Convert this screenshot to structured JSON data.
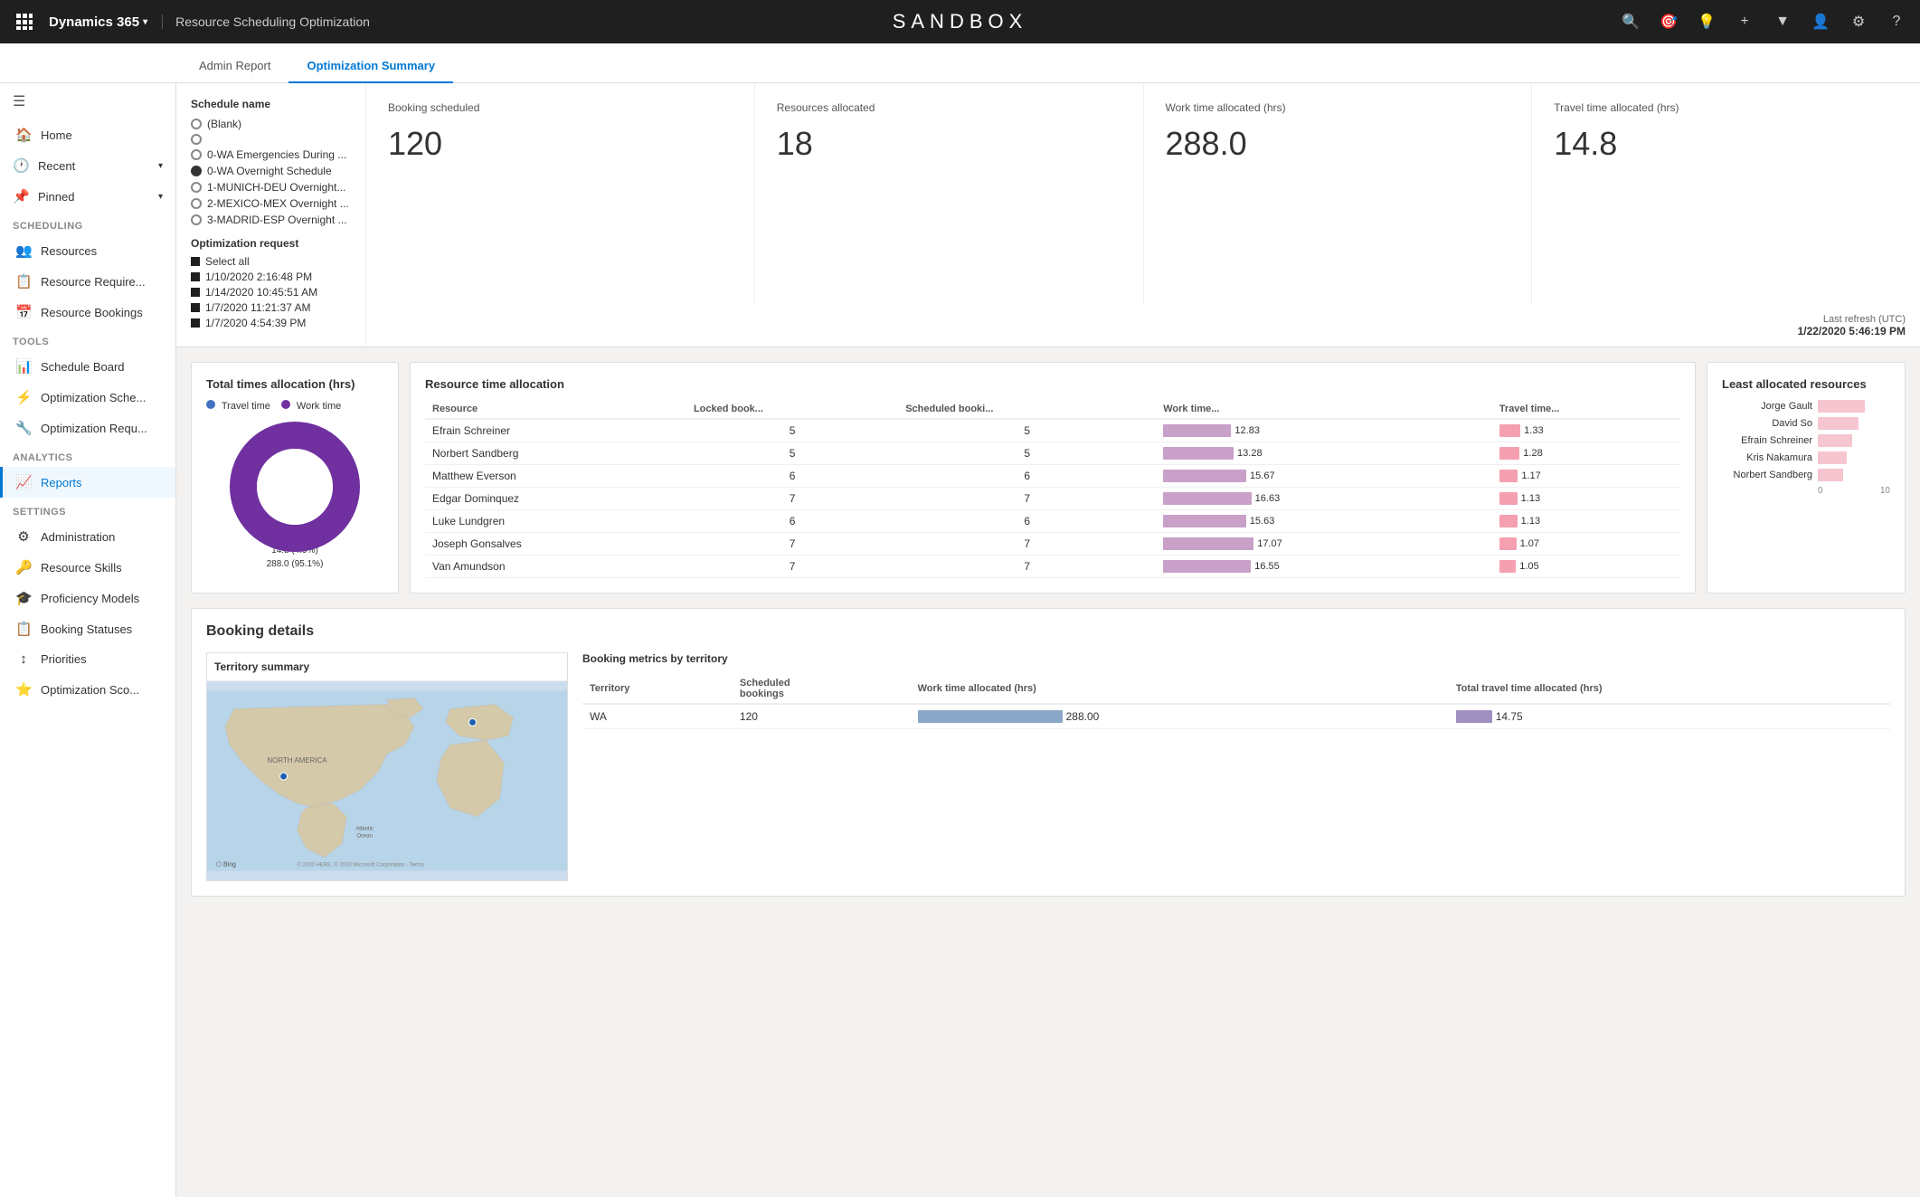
{
  "topbar": {
    "appname": "Dynamics 365",
    "chevron": "▾",
    "pagename": "Resource Scheduling Optimization",
    "sandbox": "SANDBOX",
    "icons": [
      "🔍",
      "🎯",
      "💡",
      "+",
      "▼",
      "👤",
      "⚙",
      "?"
    ]
  },
  "tabs": [
    {
      "label": "Admin Report",
      "active": false
    },
    {
      "label": "Optimization Summary",
      "active": true
    }
  ],
  "sidebar": {
    "toggle_icon": "☰",
    "sections": [
      {
        "label": "",
        "items": [
          {
            "icon": "🏠",
            "label": "Home",
            "active": false
          },
          {
            "icon": "🕐",
            "label": "Recent",
            "active": false,
            "expandable": true
          },
          {
            "icon": "📌",
            "label": "Pinned",
            "active": false,
            "expandable": true
          }
        ]
      },
      {
        "label": "Scheduling",
        "items": [
          {
            "icon": "👥",
            "label": "Resources",
            "active": false
          },
          {
            "icon": "📋",
            "label": "Resource Require...",
            "active": false
          },
          {
            "icon": "📅",
            "label": "Resource Bookings",
            "active": false
          }
        ]
      },
      {
        "label": "Tools",
        "items": [
          {
            "icon": "📊",
            "label": "Schedule Board",
            "active": false
          },
          {
            "icon": "⚡",
            "label": "Optimization Sche...",
            "active": false
          },
          {
            "icon": "🔧",
            "label": "Optimization Requ...",
            "active": false
          }
        ]
      },
      {
        "label": "Analytics",
        "items": [
          {
            "icon": "📈",
            "label": "Reports",
            "active": true
          }
        ]
      },
      {
        "label": "Settings",
        "items": [
          {
            "icon": "⚙",
            "label": "Administration",
            "active": false
          },
          {
            "icon": "🔑",
            "label": "Resource Skills",
            "active": false
          },
          {
            "icon": "🎓",
            "label": "Proficiency Models",
            "active": false
          },
          {
            "icon": "📋",
            "label": "Booking Statuses",
            "active": false
          },
          {
            "icon": "↕",
            "label": "Priorities",
            "active": false
          },
          {
            "icon": "⭐",
            "label": "Optimization Sco...",
            "active": false
          }
        ]
      }
    ]
  },
  "filter": {
    "schedule_name_label": "Schedule name",
    "schedules": [
      {
        "label": "(Blank)",
        "selected": false
      },
      {
        "label": "",
        "selected": false
      },
      {
        "label": "0-WA Emergencies During ...",
        "selected": false
      },
      {
        "label": "0-WA Overnight Schedule",
        "selected": true
      },
      {
        "label": "1-MUNICH-DEU Overnight...",
        "selected": false
      },
      {
        "label": "2-MEXICO-MEX Overnight ...",
        "selected": false
      },
      {
        "label": "3-MADRID-ESP Overnight ...",
        "selected": false
      }
    ],
    "optimization_request_label": "Optimization request",
    "requests": [
      {
        "label": "Select all",
        "selected": false
      },
      {
        "label": "1/10/2020 2:16:48 PM",
        "selected": false
      },
      {
        "label": "1/14/2020 10:45:51 AM",
        "selected": false
      },
      {
        "label": "1/7/2020 11:21:37 AM",
        "selected": false
      },
      {
        "label": "1/7/2020 4:54:39 PM",
        "selected": false
      }
    ]
  },
  "last_refresh": {
    "label": "Last refresh (UTC)",
    "value": "1/22/2020 5:46:19 PM"
  },
  "kpis": [
    {
      "label": "Booking scheduled",
      "value": "120"
    },
    {
      "label": "Resources allocated",
      "value": "18"
    },
    {
      "label": "Work time allocated (hrs)",
      "value": "288.0"
    },
    {
      "label": "Travel time allocated (hrs)",
      "value": "14.8"
    }
  ],
  "total_times": {
    "title": "Total times allocation (hrs)",
    "legend": [
      {
        "color": "#4472C4",
        "label": "Travel time"
      },
      {
        "color": "#7030A0",
        "label": "Work time"
      }
    ],
    "donut": {
      "travel_pct": 4.9,
      "work_pct": 95.1,
      "travel_label": "14.8 (4.9%)",
      "work_label": "288.0 (95.1%)"
    }
  },
  "resource_time": {
    "title": "Resource time allocation",
    "columns": [
      "Resource",
      "Locked book...",
      "Scheduled booki...",
      "Work time...",
      "Travel time..."
    ],
    "rows": [
      {
        "name": "Efrain Schreiner",
        "locked": 5,
        "scheduled": 5,
        "work": 12.83,
        "travel": 1.33
      },
      {
        "name": "Norbert Sandberg",
        "locked": 5,
        "scheduled": 5,
        "work": 13.28,
        "travel": 1.28
      },
      {
        "name": "Matthew Everson",
        "locked": 6,
        "scheduled": 6,
        "work": 15.67,
        "travel": 1.17
      },
      {
        "name": "Edgar Dominquez",
        "locked": 7,
        "scheduled": 7,
        "work": 16.63,
        "travel": 1.13
      },
      {
        "name": "Luke Lundgren",
        "locked": 6,
        "scheduled": 6,
        "work": 15.63,
        "travel": 1.13
      },
      {
        "name": "Joseph Gonsalves",
        "locked": 7,
        "scheduled": 7,
        "work": 17.07,
        "travel": 1.07
      },
      {
        "name": "Van Amundson",
        "locked": 7,
        "scheduled": 7,
        "work": 16.55,
        "travel": 1.05
      }
    ]
  },
  "least_allocated": {
    "title": "Least allocated resources",
    "names": [
      "Jorge Gault",
      "David So",
      "Efrain Schreiner",
      "Kris Nakamura",
      "Norbert Sandberg"
    ],
    "axis": [
      0,
      10
    ]
  },
  "booking_details": {
    "title": "Booking details",
    "territory_summary": {
      "title": "Territory summary",
      "map_center": "NORTH AMERICA"
    },
    "booking_metrics": {
      "title": "Booking metrics by territory",
      "columns": [
        "Territory",
        "Scheduled bookings",
        "Work time allocated (hrs)",
        "Total travel time allocated (hrs)"
      ],
      "rows": [
        {
          "territory": "WA",
          "scheduled": 120,
          "work_bar_pct": 70,
          "work_val": "288.00",
          "travel_bar_pct": 20,
          "travel_val": "14.75"
        }
      ]
    }
  }
}
